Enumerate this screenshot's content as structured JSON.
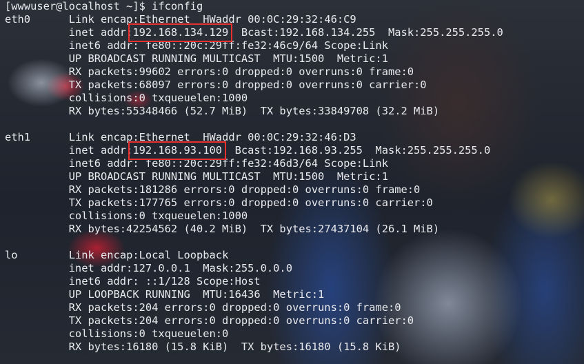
{
  "prompt": "[wwwuser@localhost ~]$ ifconfig",
  "interfaces": [
    {
      "name": "eth0",
      "lines": [
        "Link encap:Ethernet  HWaddr 00:0C:29:32:46:C9",
        "inet addr:192.168.134.129  Bcast:192.168.134.255  Mask:255.255.255.0",
        "inet6 addr: fe80::20c:29ff:fe32:46c9/64 Scope:Link",
        "UP BROADCAST RUNNING MULTICAST  MTU:1500  Metric:1",
        "RX packets:99602 errors:0 dropped:0 overruns:0 frame:0",
        "TX packets:68097 errors:0 dropped:0 overruns:0 carrier:0",
        "collisions:0 txqueuelen:1000",
        "RX bytes:55348466 (52.7 MiB)  TX bytes:33849708 (32.2 MiB)"
      ]
    },
    {
      "name": "eth1",
      "lines": [
        "Link encap:Ethernet  HWaddr 00:0C:29:32:46:D3",
        "inet addr:192.168.93.100  Bcast:192.168.93.255  Mask:255.255.255.0",
        "inet6 addr: fe80::20c:29ff:fe32:46d3/64 Scope:Link",
        "UP BROADCAST RUNNING MULTICAST  MTU:1500  Metric:1",
        "RX packets:181286 errors:0 dropped:0 overruns:0 frame:0",
        "TX packets:177765 errors:0 dropped:0 overruns:0 carrier:0",
        "collisions:0 txqueuelen:1000",
        "RX bytes:42254562 (40.2 MiB)  TX bytes:27437104 (26.1 MiB)"
      ]
    },
    {
      "name": "lo",
      "lines": [
        "Link encap:Local Loopback",
        "inet addr:127.0.0.1  Mask:255.0.0.0",
        "inet6 addr: ::1/128 Scope:Host",
        "UP LOOPBACK RUNNING  MTU:16436  Metric:1",
        "RX packets:204 errors:0 dropped:0 overruns:0 frame:0",
        "TX packets:204 errors:0 dropped:0 overruns:0 carrier:0",
        "collisions:0 txqueuelen:0",
        "RX bytes:16180 (15.8 KiB)  TX bytes:16180 (15.8 KiB)"
      ]
    }
  ],
  "colors": {
    "text": "#e9eaee",
    "highlight_box": "#e8312f"
  }
}
